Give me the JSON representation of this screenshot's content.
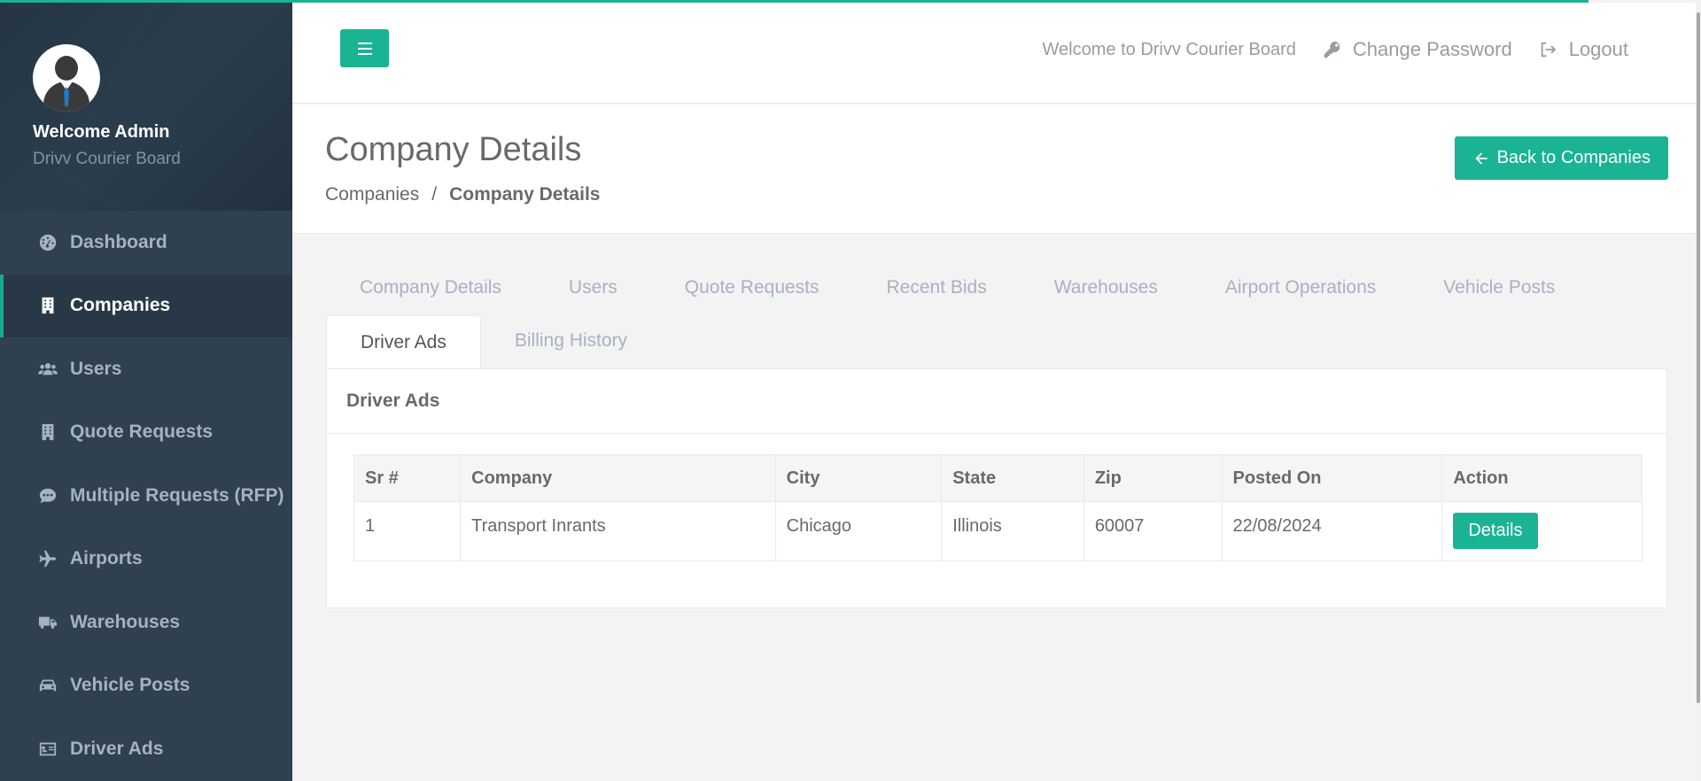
{
  "colors": {
    "accent": "#1ab394",
    "sidebar": "#2f4050",
    "sidebar_active": "#293846"
  },
  "sidebar": {
    "profile": {
      "name": "Welcome Admin",
      "subtitle": "Drivv Courier Board"
    },
    "items": [
      {
        "label": "Dashboard",
        "icon": "dashboard-icon",
        "active": false
      },
      {
        "label": "Companies",
        "icon": "building-icon",
        "active": true
      },
      {
        "label": "Users",
        "icon": "users-icon",
        "active": false
      },
      {
        "label": "Quote Requests",
        "icon": "building-icon",
        "active": false
      },
      {
        "label": "Multiple Requests (RFP)",
        "icon": "comment-icon",
        "active": false
      },
      {
        "label": "Airports",
        "icon": "plane-icon",
        "active": false
      },
      {
        "label": "Warehouses",
        "icon": "truck-icon",
        "active": false
      },
      {
        "label": "Vehicle Posts",
        "icon": "car-icon",
        "active": false
      },
      {
        "label": "Driver Ads",
        "icon": "id-card-icon",
        "active": false
      }
    ]
  },
  "topbar": {
    "welcome": "Welcome to Drivv Courier Board",
    "change_password": "Change Password",
    "logout": "Logout"
  },
  "heading": {
    "title": "Company Details",
    "breadcrumb": [
      "Companies",
      "Company Details"
    ],
    "back_button": "Back to Companies"
  },
  "tabs": {
    "row1": [
      "Company Details",
      "Users",
      "Quote Requests",
      "Recent Bids",
      "Warehouses",
      "Airport Operations",
      "Vehicle Posts"
    ],
    "row2": [
      "Driver Ads",
      "Billing History"
    ],
    "active": "Driver Ads"
  },
  "panel": {
    "title": "Driver Ads",
    "columns": [
      "Sr #",
      "Company",
      "City",
      "State",
      "Zip",
      "Posted On",
      "Action"
    ],
    "rows": [
      {
        "sr": "1",
        "company": "Transport Inrants",
        "city": "Chicago",
        "state": "Illinois",
        "zip": "60007",
        "posted_on": "22/08/2024",
        "action": "Details"
      }
    ]
  }
}
